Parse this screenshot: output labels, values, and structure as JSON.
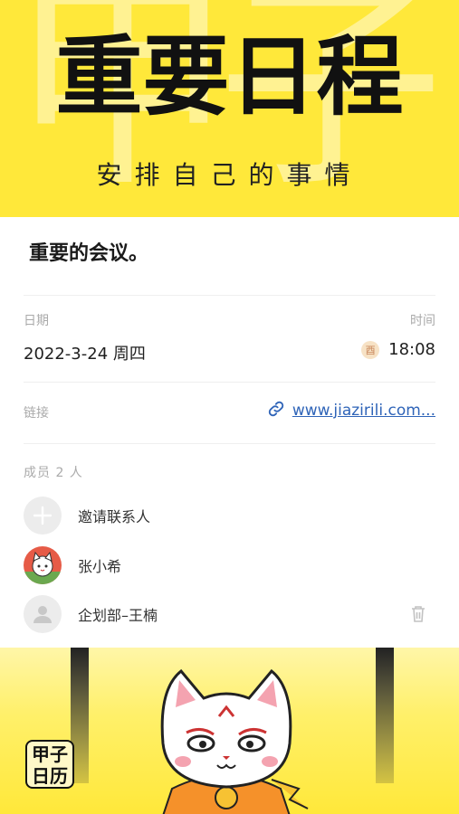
{
  "hero": {
    "title": "重要日程",
    "subtitle": "安排自己的事情",
    "watermark": "甲子",
    "bg_color": "#ffe83a"
  },
  "event": {
    "title": "重要的会议。",
    "date_label": "日期",
    "date_value": "2022-3-24 周四",
    "time_label": "时间",
    "time_icon_text": "酉",
    "time_value": "18:08",
    "link_label": "链接",
    "link_icon": "link-icon",
    "link_text": "www.jiazirili.com...",
    "link_color": "#2f64b8",
    "members_label": "成员 2 人",
    "members": [
      {
        "name": "邀请联系人",
        "avatar": "plus-icon"
      },
      {
        "name": "张小希",
        "avatar": "cat-avatar"
      },
      {
        "name": "企划部–王楠",
        "avatar": "person-icon",
        "action": "trash-icon"
      }
    ]
  },
  "banner": {
    "logo_text": "甲子日历",
    "logo_line1": "甲子",
    "logo_line2": "日历"
  }
}
